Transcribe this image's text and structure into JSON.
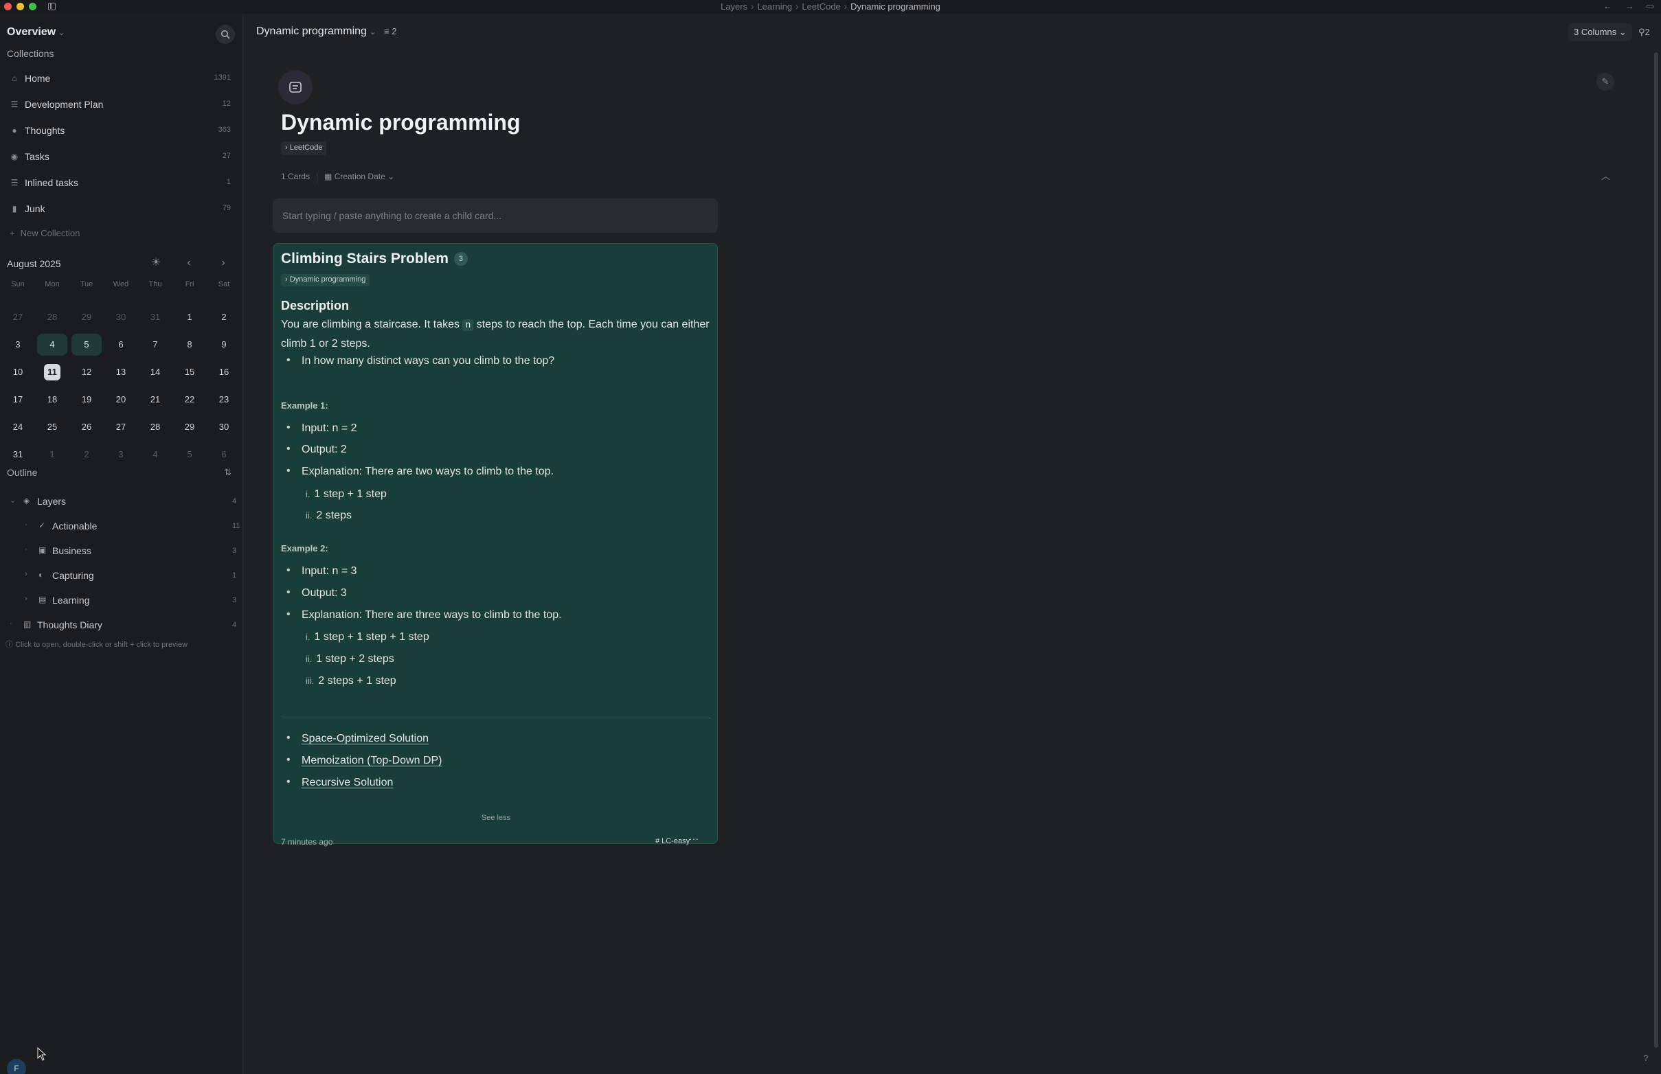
{
  "titlebar": {
    "breadcrumbs": [
      "Layers",
      "Learning",
      "LeetCode",
      "Dynamic programming"
    ],
    "back_icon": "arrow-left-icon",
    "forward_icon": "arrow-right-icon"
  },
  "sidebar": {
    "overview_label": "Overview",
    "collections_label": "Collections",
    "collections": [
      {
        "label": "Home",
        "count": "1391",
        "icon": "home-icon"
      },
      {
        "label": "Development Plan",
        "count": "12",
        "icon": "list-icon"
      },
      {
        "label": "Thoughts",
        "count": "363",
        "icon": "chat-bubble-icon"
      },
      {
        "label": "Tasks",
        "count": "27",
        "icon": "check-circle-icon"
      },
      {
        "label": "Inlined tasks",
        "count": "1",
        "icon": "list-icon"
      },
      {
        "label": "Junk",
        "count": "79",
        "icon": "trash-icon"
      }
    ],
    "new_collection_label": "New Collection",
    "calendar": {
      "month_label": "August 2025",
      "days_of_week": [
        "Sun",
        "Mon",
        "Tue",
        "Wed",
        "Thu",
        "Fri",
        "Sat"
      ],
      "weeks": [
        [
          "27",
          "28",
          "29",
          "30",
          "31",
          "1",
          "2"
        ],
        [
          "3",
          "4",
          "5",
          "6",
          "7",
          "8",
          "9"
        ],
        [
          "10",
          "11",
          "12",
          "13",
          "14",
          "15",
          "16"
        ],
        [
          "17",
          "18",
          "19",
          "20",
          "21",
          "22",
          "23"
        ],
        [
          "24",
          "25",
          "26",
          "27",
          "28",
          "29",
          "30"
        ],
        [
          "31",
          "1",
          "2",
          "3",
          "4",
          "5",
          "6"
        ]
      ],
      "today": "11",
      "highlighted_days": [
        "4",
        "5"
      ]
    },
    "outline_label": "Outline",
    "outline": [
      {
        "label": "Layers",
        "count": "4",
        "depth": 0,
        "icon": "layers-icon"
      },
      {
        "label": "Actionable",
        "count": "11",
        "depth": 1,
        "icon": "check-list-icon"
      },
      {
        "label": "Business",
        "count": "3",
        "depth": 1,
        "icon": "briefcase-icon"
      },
      {
        "label": "Capturing",
        "count": "1",
        "depth": 1,
        "icon": "capture-icon"
      },
      {
        "label": "Learning",
        "count": "3",
        "depth": 1,
        "icon": "book-icon"
      },
      {
        "label": "Thoughts Diary",
        "count": "4",
        "depth": 0,
        "icon": "notebook-icon"
      }
    ],
    "hint": "Click to open, double-click or shift + click to preview",
    "avatar_initial": "F"
  },
  "main": {
    "view_title": "Dynamic programming",
    "filter_count": "2",
    "columns_label": "3 Columns",
    "pin_count": "2",
    "page_title": "Dynamic programming",
    "parent_tag": "LeetCode",
    "cards_count": "1 Cards",
    "sort_label": "Creation Date",
    "new_card_placeholder": "Start typing / paste anything to create a child card...",
    "card": {
      "title": "Climbing Stairs Problem",
      "badge": "3",
      "tag": "Dynamic programming",
      "description_heading": "Description",
      "desc_part1": "You are climbing a staircase. It takes",
      "desc_code": "n",
      "desc_part2": "steps to reach the top. Each time you can either climb 1 or 2 steps.",
      "question": "In how many distinct ways can you climb to the top?",
      "example1_label": "Example 1:",
      "example1_items": [
        "Input: n = 2",
        "Output: 2",
        "Explanation: There are two ways to climb to the top."
      ],
      "example1_sub": [
        {
          "num": "i.",
          "text": "1 step + 1 step"
        },
        {
          "num": "ii.",
          "text": "2 steps"
        }
      ],
      "example2_label": "Example 2:",
      "example2_items": [
        "Input: n = 3",
        "Output: 3",
        "Explanation: There are three ways to climb to the top."
      ],
      "example2_sub": [
        {
          "num": "i.",
          "text": "1 step + 1 step + 1 step"
        },
        {
          "num": "ii.",
          "text": "1 step + 2 steps"
        },
        {
          "num": "iii.",
          "text": "2 steps + 1 step"
        }
      ],
      "links": [
        "Space-Optimized Solution",
        "Memoization (Top-Down DP)",
        "Recursive Solution"
      ],
      "see_less": "See less",
      "timestamp": "7 minutes ago",
      "hashtag": "# LC-easy",
      "more_icon": "ellipsis-icon"
    }
  },
  "colors": {
    "card_bg": "#193d38",
    "sidebar_bg": "#1b1c1e",
    "main_bg": "#1f2022",
    "accent_highlight": "#1f3b35"
  }
}
